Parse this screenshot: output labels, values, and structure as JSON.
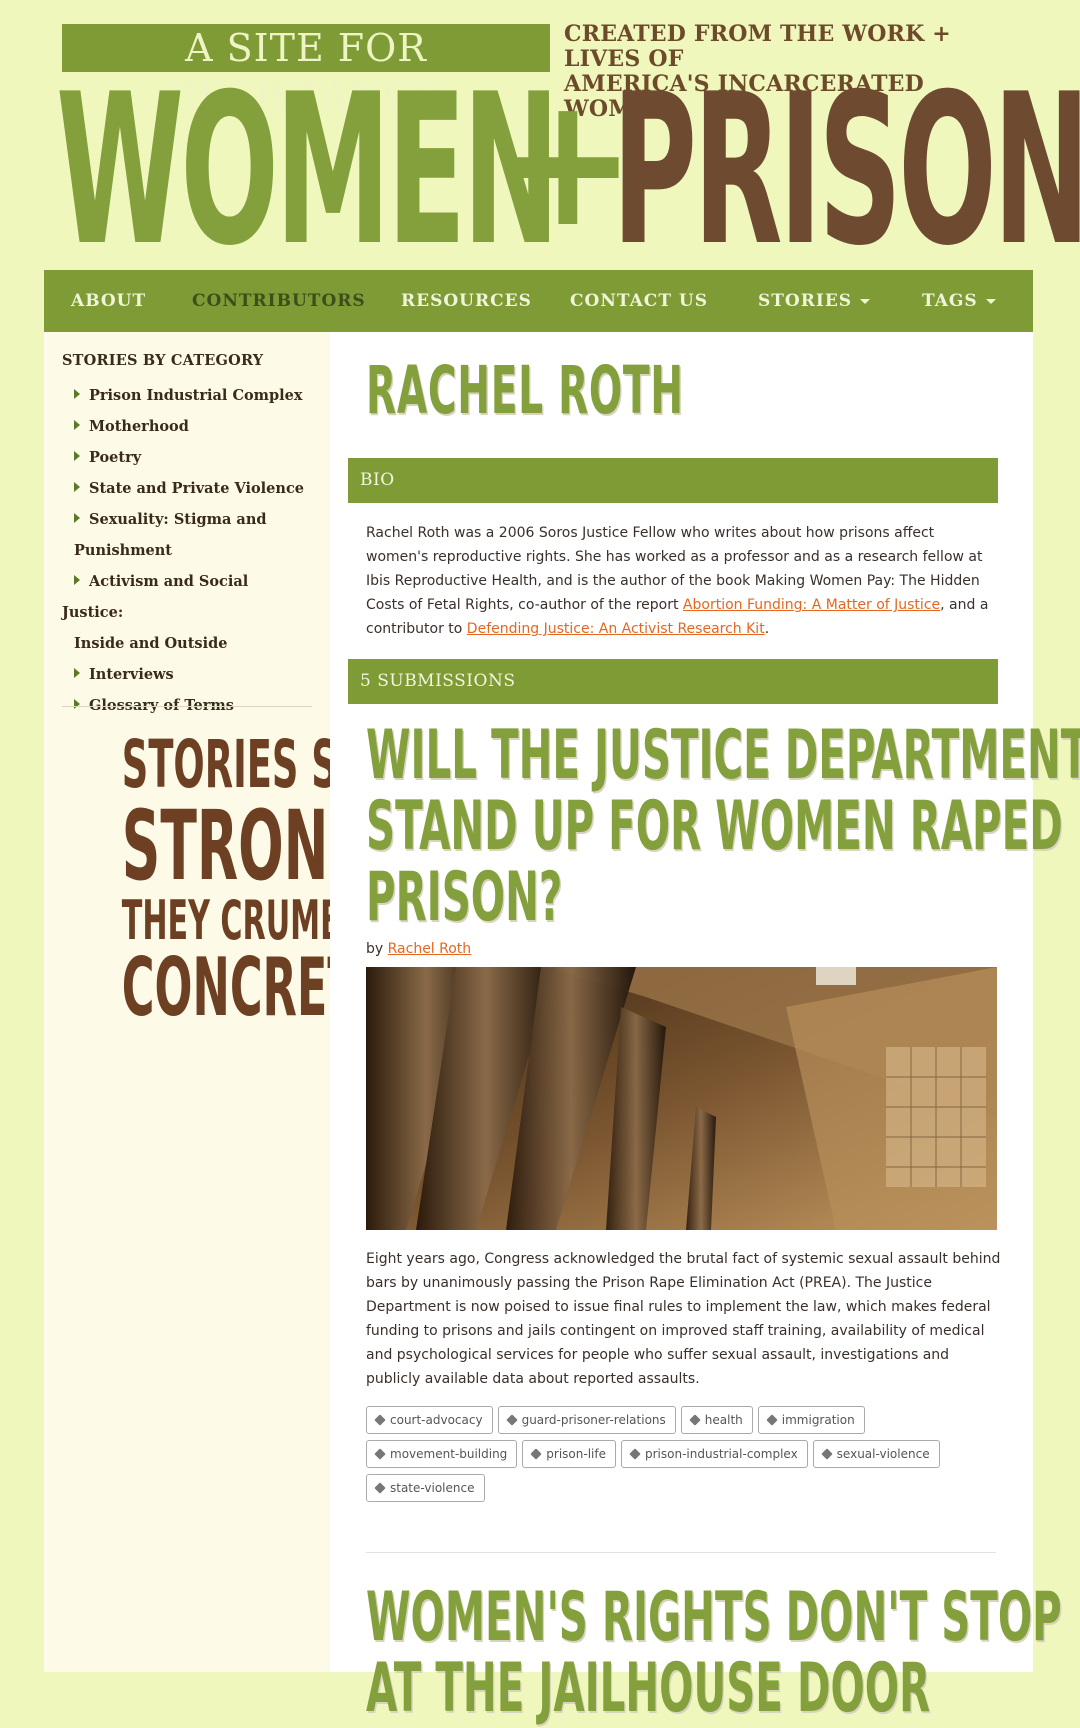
{
  "header": {
    "tagline": "A SITE FOR RESISTANCE",
    "created_line1": "CREATED FROM THE WORK + LIVES OF",
    "created_line2": "AMERICA'S INCARCERATED WOMEN",
    "logo_women": "WOMEN",
    "logo_plus": "+",
    "logo_prison": "PRISON"
  },
  "nav": {
    "items": [
      {
        "label": "ABOUT"
      },
      {
        "label": "CONTRIBUTORS",
        "active": true
      },
      {
        "label": "RESOURCES"
      },
      {
        "label": "CONTACT US"
      },
      {
        "label": "STORIES",
        "dropdown": true
      },
      {
        "label": "TAGS",
        "dropdown": true
      }
    ]
  },
  "sidebar": {
    "title": "STORIES BY CATEGORY",
    "categories": [
      {
        "label": "Prison Industrial Complex"
      },
      {
        "label": "Motherhood"
      },
      {
        "label": "Poetry"
      },
      {
        "label": "State and Private Violence"
      },
      {
        "label_line1": "Sexuality: Stigma and",
        "label_line2": "Punishment"
      },
      {
        "label_line1": "Activism and Social Justice:",
        "label_line2": "Inside and Outside"
      },
      {
        "label": "Interviews"
      },
      {
        "label": "Glossary of Terms"
      }
    ],
    "slogan": [
      "STORIES SO",
      "STRONG",
      "THEY CRUMBLE",
      "CONCRETE"
    ]
  },
  "main": {
    "page_title": "RACHEL ROTH",
    "bio_heading": "BIO",
    "bio": {
      "text_before_link1": "Rachel Roth was a 2006 Soros Justice Fellow who writes about how prisons affect women's reproductive rights. She has worked as a professor and as a research fellow at Ibis Reproductive Health, and is the author of the book Making Women Pay: The Hidden Costs of Fetal Rights, co-author of the report ",
      "link1": "Abortion Funding: A Matter of Justice",
      "text_between": ", and a contributor to ",
      "link2": "Defending Justice: An Activist Research Kit",
      "text_after": "."
    },
    "submissions_heading": "5 SUBMISSIONS",
    "posts": [
      {
        "title_lines": [
          "WILL THE JUSTICE DEPARTMENT",
          "STAND UP FOR WOMEN RAPED IN",
          "PRISON?"
        ],
        "by_label": "by ",
        "author": "Rachel Roth",
        "excerpt": "Eight years ago, Congress acknowledged the brutal fact of systemic sexual assault behind bars by unanimously passing the Prison Rape Elimination Act (PREA). The Justice Department is now poised to issue final rules to implement the law, which makes federal funding to prisons and jails contingent on improved staff training, availability of medical and psychological services for people who suffer sexual assault, investigations and publicly available data about reported assaults.",
        "tags": [
          "court-advocacy",
          "guard-prisoner-relations",
          "health",
          "immigration",
          "movement-building",
          "prison-life",
          "prison-industrial-complex",
          "sexual-violence",
          "state-violence"
        ]
      },
      {
        "title_lines": [
          "WOMEN'S RIGHTS DON'T STOP",
          "AT THE JAILHOUSE DOOR"
        ]
      }
    ]
  },
  "colors": {
    "page_bg": "#eff7bd",
    "green": "#7e9b35",
    "brown": "#6e4b30",
    "link": "#e5671f"
  }
}
